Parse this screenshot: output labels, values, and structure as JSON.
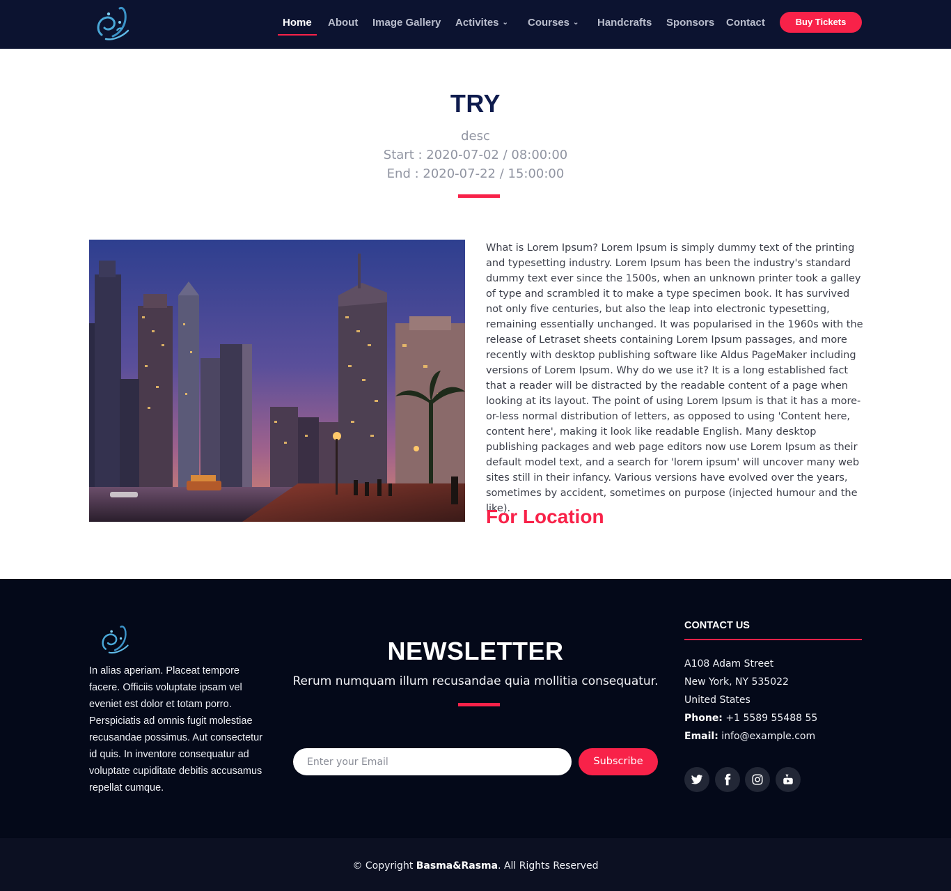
{
  "nav": {
    "items": [
      {
        "label": "Home",
        "active": true
      },
      {
        "label": "About"
      },
      {
        "label": "Image Gallery"
      },
      {
        "label": "Activites",
        "dropdown": true
      },
      {
        "label": "Courses",
        "dropdown": true
      },
      {
        "label": "Handcrafts"
      },
      {
        "label": "Sponsors"
      },
      {
        "label": "Contact"
      }
    ],
    "cta": "Buy Tickets",
    "logo_icon": "calligraphy-logo-icon"
  },
  "event": {
    "title": "TRY",
    "desc": "desc",
    "start": "Start : 2020-07-02 / 08:00:00",
    "end": "End : 2020-07-22 / 15:00:00",
    "body": "What is Lorem Ipsum? Lorem Ipsum is simply dummy text of the printing and typesetting industry. Lorem Ipsum has been the industry's standard dummy text ever since the 1500s, when an unknown printer took a galley of type and scrambled it to make a type specimen book. It has survived not only five centuries, but also the leap into electronic typesetting, remaining essentially unchanged. It was popularised in the 1960s with the release of Letraset sheets containing Lorem Ipsum passages, and more recently with desktop publishing software like Aldus PageMaker including versions of Lorem Ipsum. Why do we use it? It is a long established fact that a reader will be distracted by the readable content of a page when looking at its layout. The point of using Lorem Ipsum is that it has a more-or-less normal distribution of letters, as opposed to using 'Content here, content here', making it look like readable English. Many desktop publishing packages and web page editors now use Lorem Ipsum as their default model text, and a search for 'lorem ipsum' will uncover many web sites still in their infancy. Various versions have evolved over the years, sometimes by accident, sometimes on purpose (injected humour and the like).",
    "location_heading": "For Location"
  },
  "footer": {
    "about": "In alias aperiam. Placeat tempore facere. Officiis voluptate ipsam vel eveniet est dolor et totam porro. Perspiciatis ad omnis fugit molestiae recusandae possimus. Aut consectetur id quis. In inventore consequatur ad voluptate cupiditate debitis accusamus repellat cumque.",
    "newsletter": {
      "title": "NEWSLETTER",
      "subtitle": "Rerum numquam illum recusandae quia mollitia consequatur.",
      "placeholder": "Enter your Email",
      "button": "Subscribe"
    },
    "contact": {
      "title": "CONTACT US",
      "address1": "A108 Adam Street",
      "address2": "New York, NY 535022",
      "country": "United States",
      "phone_label": "Phone:",
      "phone": "+1 5589 55488 55",
      "email_label": "Email:",
      "email": "info@example.com"
    },
    "social": [
      "twitter-icon",
      "facebook-icon",
      "instagram-icon",
      "youtube-icon"
    ],
    "copyright_prefix": "© Copyright",
    "copyright_brand": "Basma&Rasma",
    "copyright_suffix": ". All Rights Reserved"
  },
  "colors": {
    "header_bg": "#0c1330",
    "accent": "#f82249",
    "title": "#0e1b4d",
    "footer_bg": "#040919"
  }
}
